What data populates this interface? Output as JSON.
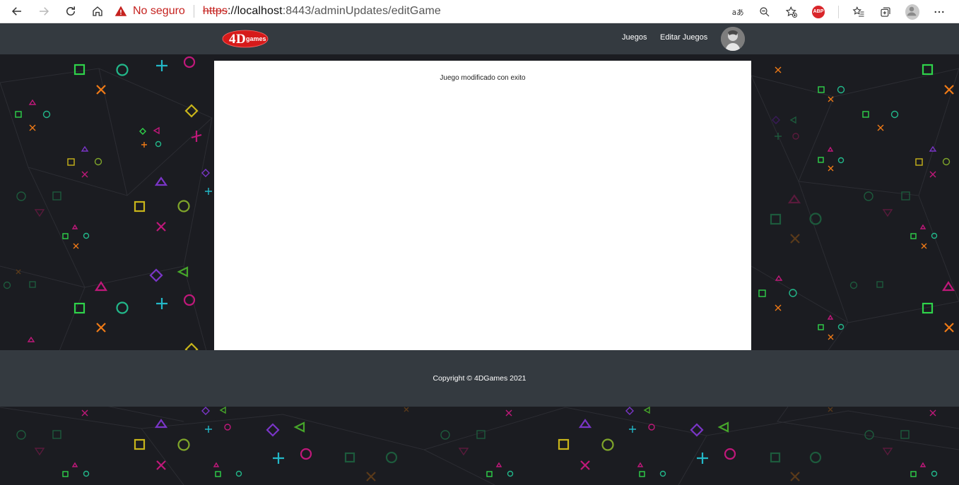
{
  "browser": {
    "security_label": "No seguro",
    "url_scheme": "https",
    "url_rest": "://localhost",
    "url_path": ":8443/adminUpdates/editGame",
    "abp_label": "ABP"
  },
  "header": {
    "logo_text": "4Dgames",
    "nav": [
      {
        "label": "Juegos"
      },
      {
        "label": "Editar Juegos"
      }
    ]
  },
  "main": {
    "message": "Juego modificado con exito"
  },
  "footer": {
    "copyright": "Copyright © 4DGames 2021"
  },
  "colors": {
    "navbar": "#343a40",
    "background": "#1b1c21",
    "insecure_red": "#c5221f"
  }
}
